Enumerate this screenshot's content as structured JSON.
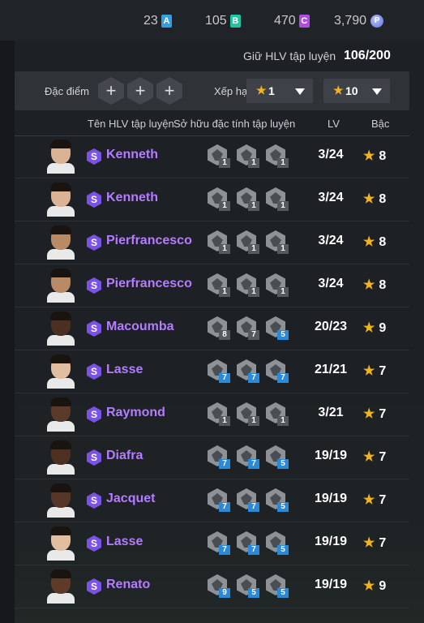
{
  "currencies": [
    {
      "value": "23",
      "badge": "A",
      "color": "#2fa0e8"
    },
    {
      "value": "105",
      "badge": "B",
      "color": "#1fc4a0"
    },
    {
      "value": "470",
      "badge": "C",
      "color": "#b04ce0"
    },
    {
      "value": "3,790",
      "badge": "P",
      "color": "#6b7fe6"
    }
  ],
  "capacity": {
    "label": "Giữ HLV tập luyện",
    "value": "106/200"
  },
  "filter": {
    "trait_label": "Đặc điểm đ",
    "plus": "+",
    "rank_label": "Xếp hạ",
    "from": "1",
    "to": "10",
    "separator": "~",
    "star": "★"
  },
  "headers": {
    "name": "Tên HLV tập luyện",
    "traits": "Sở hữu đặc tính tập luyện",
    "lv": "LV",
    "grade": "Bậc"
  },
  "badge_letter": "S",
  "rows": [
    {
      "name": "Kenneth",
      "skin": "#d9b394",
      "skills": [
        {
          "level": "1",
          "tier": "gray",
          "icon": "skill-icon-a"
        },
        {
          "level": "1",
          "tier": "gray",
          "icon": "skill-icon-b"
        },
        {
          "level": "1",
          "tier": "gray",
          "icon": "skill-icon-c"
        }
      ],
      "lv": "3/24",
      "grade": "8"
    },
    {
      "name": "Kenneth",
      "skin": "#d9b394",
      "skills": [
        {
          "level": "1",
          "tier": "gray",
          "icon": "skill-icon-a"
        },
        {
          "level": "1",
          "tier": "gray",
          "icon": "skill-icon-b"
        },
        {
          "level": "1",
          "tier": "gray",
          "icon": "skill-icon-c"
        }
      ],
      "lv": "3/24",
      "grade": "8"
    },
    {
      "name": "Pierfrancesco",
      "skin": "#b98a66",
      "skills": [
        {
          "level": "1",
          "tier": "gray",
          "icon": "skill-icon-a"
        },
        {
          "level": "1",
          "tier": "gray",
          "icon": "skill-icon-d"
        },
        {
          "level": "1",
          "tier": "gray",
          "icon": "skill-icon-c"
        }
      ],
      "lv": "3/24",
      "grade": "8"
    },
    {
      "name": "Pierfrancesco",
      "skin": "#b98a66",
      "skills": [
        {
          "level": "1",
          "tier": "gray",
          "icon": "skill-icon-e"
        },
        {
          "level": "1",
          "tier": "gray",
          "icon": "skill-icon-b"
        },
        {
          "level": "1",
          "tier": "gray",
          "icon": "skill-icon-c"
        }
      ],
      "lv": "3/24",
      "grade": "8"
    },
    {
      "name": "Macoumba",
      "skin": "#4a2f22",
      "skills": [
        {
          "level": "8",
          "tier": "gray",
          "icon": "skill-icon-d"
        },
        {
          "level": "7",
          "tier": "gray",
          "icon": "skill-icon-c"
        },
        {
          "level": "5",
          "tier": "blue",
          "icon": "skill-icon-f"
        }
      ],
      "lv": "20/23",
      "grade": "9"
    },
    {
      "name": "Lasse",
      "skin": "#e2bea0",
      "skills": [
        {
          "level": "7",
          "tier": "blue",
          "icon": "skill-icon-c"
        },
        {
          "level": "7",
          "tier": "blue",
          "icon": "skill-icon-g"
        },
        {
          "level": "7",
          "tier": "blue",
          "icon": "skill-icon-c"
        }
      ],
      "lv": "21/21",
      "grade": "7"
    },
    {
      "name": "Raymond",
      "skin": "#5a3a28",
      "skills": [
        {
          "level": "1",
          "tier": "gray",
          "icon": "skill-icon-a"
        },
        {
          "level": "1",
          "tier": "gray",
          "icon": "skill-icon-e"
        },
        {
          "level": "1",
          "tier": "gray",
          "icon": "skill-icon-c"
        }
      ],
      "lv": "3/21",
      "grade": "7"
    },
    {
      "name": "Diafra",
      "skin": "#4d3022",
      "skills": [
        {
          "level": "7",
          "tier": "blue",
          "icon": "skill-icon-e"
        },
        {
          "level": "7",
          "tier": "blue",
          "icon": "skill-icon-c"
        },
        {
          "level": "5",
          "tier": "blue",
          "icon": "skill-icon-f"
        }
      ],
      "lv": "19/19",
      "grade": "7"
    },
    {
      "name": "Jacquet",
      "skin": "#563626",
      "skills": [
        {
          "level": "7",
          "tier": "blue",
          "icon": "skill-icon-a"
        },
        {
          "level": "7",
          "tier": "blue",
          "icon": "skill-icon-c"
        },
        {
          "level": "5",
          "tier": "blue",
          "icon": "skill-icon-c"
        }
      ],
      "lv": "19/19",
      "grade": "7"
    },
    {
      "name": "Lasse",
      "skin": "#e2bea0",
      "skills": [
        {
          "level": "7",
          "tier": "blue",
          "icon": "skill-icon-c"
        },
        {
          "level": "7",
          "tier": "blue",
          "icon": "skill-icon-g"
        },
        {
          "level": "5",
          "tier": "blue",
          "icon": "skill-icon-h"
        }
      ],
      "lv": "19/19",
      "grade": "7"
    },
    {
      "name": "Renato",
      "skin": "#5e3b29",
      "skills": [
        {
          "level": "9",
          "tier": "blue",
          "icon": "skill-icon-c"
        },
        {
          "level": "5",
          "tier": "blue",
          "icon": "skill-icon-i"
        },
        {
          "level": "5",
          "tier": "blue",
          "icon": "skill-icon-h"
        }
      ],
      "lv": "19/19",
      "grade": "9"
    }
  ]
}
